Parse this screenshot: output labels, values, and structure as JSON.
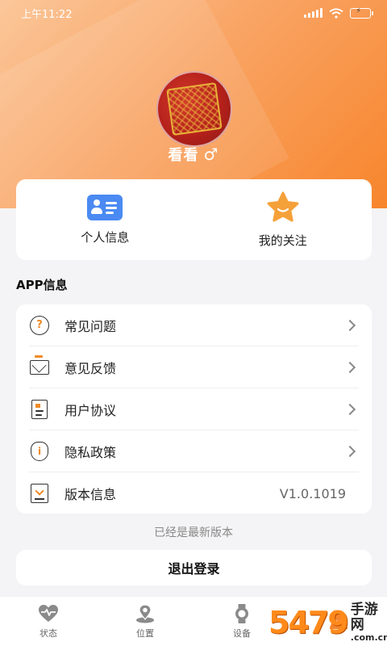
{
  "status_bar": {
    "time": "上午11:22",
    "battery_icon": "battery-charging-icon",
    "wifi_icon": "wifi-icon",
    "signal_icon": "signal-icon"
  },
  "profile": {
    "nickname": "看看",
    "gender_symbol": "♂",
    "avatar_icon": "avatar-seal-image"
  },
  "quick_actions": [
    {
      "label": "个人信息",
      "icon": "id-card-icon"
    },
    {
      "label": "我的关注",
      "icon": "star-icon"
    }
  ],
  "section_title": "APP信息",
  "menu": [
    {
      "label": "常见问题",
      "icon": "question-icon",
      "symbol": "?"
    },
    {
      "label": "意见反馈",
      "icon": "feedback-mail-icon"
    },
    {
      "label": "用户协议",
      "icon": "agreement-doc-icon"
    },
    {
      "label": "隐私政策",
      "icon": "privacy-shield-icon",
      "symbol": "i"
    },
    {
      "label": "版本信息",
      "icon": "version-download-icon",
      "value": "V1.0.1019"
    }
  ],
  "latest_note": "已经是最新版本",
  "logout_label": "退出登录",
  "tabs": [
    {
      "label": "状态",
      "icon": "heart-pulse-icon"
    },
    {
      "label": "位置",
      "icon": "location-pin-icon"
    },
    {
      "label": "设备",
      "icon": "watch-icon"
    },
    {
      "label": "",
      "icon": "profile-icon"
    }
  ],
  "watermark": {
    "number": "5479",
    "line1": "手游网",
    "line2": ".com.cn"
  },
  "colors": {
    "accent": "#f7852c",
    "header_light": "#fbc79a",
    "id_card": "#4a8af2",
    "star": "#f5a13a"
  }
}
